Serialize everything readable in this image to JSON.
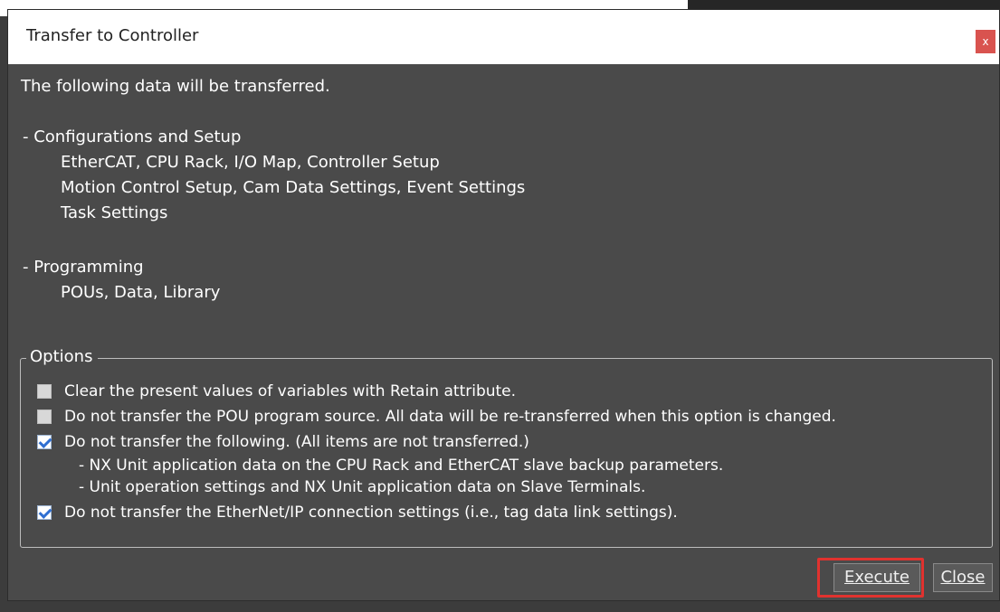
{
  "dialog": {
    "title": "Transfer to Controller",
    "close_x": "x",
    "intro": "The following data will be transferred.",
    "sections": [
      {
        "heading": "- Configurations and Setup",
        "lines": [
          "EtherCAT, CPU Rack, I/O Map, Controller Setup",
          "Motion Control Setup, Cam Data Settings, Event Settings",
          "Task Settings"
        ]
      },
      {
        "heading": "- Programming",
        "lines": [
          "POUs, Data, Library"
        ]
      }
    ],
    "options": {
      "legend": "Options",
      "items": [
        {
          "label": "Clear the present values of variables with Retain attribute.",
          "checked": false
        },
        {
          "label": "Do not transfer the POU program source. All data will be re-transferred when this option is changed.",
          "checked": false
        },
        {
          "label": "Do not transfer the following. (All items are not transferred.)",
          "checked": true
        },
        {
          "label": "Do not transfer the EtherNet/IP connection settings (i.e., tag data link settings).",
          "checked": true
        }
      ],
      "subitems": [
        "- NX Unit application data on the CPU Rack and EtherCAT slave backup parameters.",
        "- Unit operation settings and NX Unit application data on Slave Terminals."
      ]
    },
    "buttons": {
      "execute": "Execute",
      "close": "Close"
    }
  },
  "colors": {
    "accent_highlight": "#e0322f",
    "dialog_bg": "#4a4a4a",
    "check": "#2f6fd2"
  }
}
